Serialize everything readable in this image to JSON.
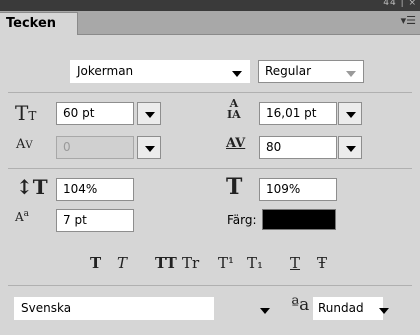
{
  "panel": {
    "title": "Tecken",
    "window_controls": "44 | ×",
    "menu_icon": "panel-menu-icon"
  },
  "font": {
    "family": "Jokerman",
    "style": "Regular"
  },
  "size": {
    "font_size": "60 pt",
    "leading": "16,01 pt"
  },
  "spacing": {
    "kerning": "0",
    "tracking": "80"
  },
  "scale": {
    "vertical": "104%",
    "horizontal": "109%"
  },
  "baseline": {
    "shift": "7 pt"
  },
  "color": {
    "label": "Färg:",
    "value": "#000000"
  },
  "style_buttons": [
    "T",
    "T",
    "TT",
    "Tr",
    "T¹",
    "T₁",
    "T",
    "Ŧ"
  ],
  "language": {
    "value": "Svenska"
  },
  "antialias": {
    "icon_text": "ªa",
    "value": "Rundad"
  }
}
